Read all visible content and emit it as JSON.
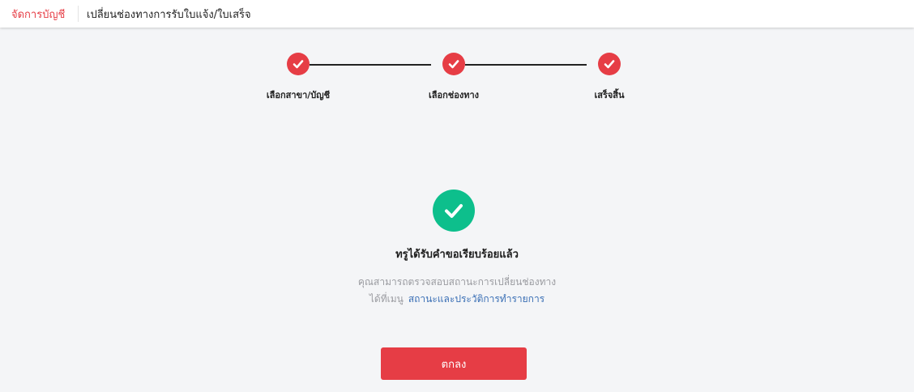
{
  "header": {
    "breadcrumb_root": "จัดการบัญชี",
    "breadcrumb_current": "เปลี่ยนช่องทางการรับใบแจ้ง/ใบเสร็จ"
  },
  "stepper": {
    "steps": [
      {
        "label": "เลือกสาขา/บัญชี",
        "status": "done",
        "icon": "check-icon"
      },
      {
        "label": "เลือกช่องทาง",
        "status": "done",
        "icon": "check-icon"
      },
      {
        "label": "เสร็จสิ้น",
        "status": "done",
        "icon": "check-icon"
      }
    ]
  },
  "result": {
    "icon": "check-circle-icon",
    "title": "ทรูได้รับคำขอเรียบร้อยแล้ว",
    "description_line1": "คุณสามารถตรวจสอบสถานะการเปลี่ยนช่องทาง",
    "description_line2_prefix": "ได้ที่เมนู",
    "description_link": "สถานะและประวัติการทำรายการ"
  },
  "actions": {
    "ok_label": "ตกลง"
  },
  "colors": {
    "accent": "#e63d45",
    "success": "#0dbf8c",
    "link": "#3a6fb5",
    "background": "#f4f5f7"
  }
}
